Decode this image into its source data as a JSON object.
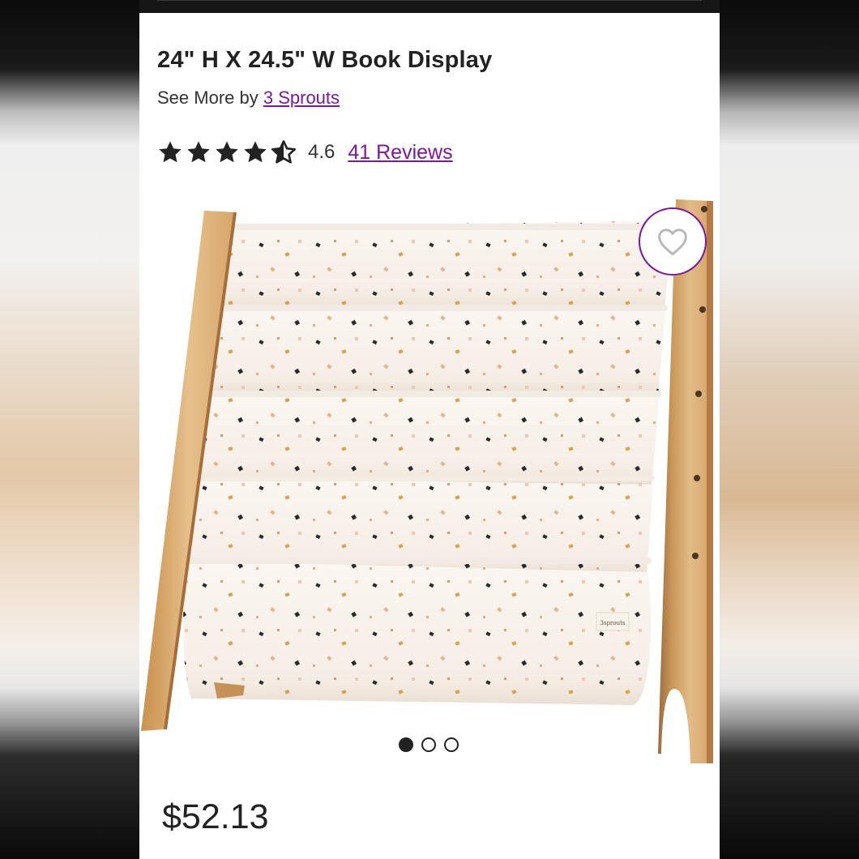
{
  "product": {
    "title": "24\" H X 24.5\" W Book Display",
    "see_more_prefix": "See More by",
    "brand": "3 Sprouts",
    "rating": "4.6",
    "rating_fraction": 0.92,
    "reviews_link": "41 Reviews",
    "price": "$52.13",
    "image_alt": "Book display with wooden sides and speckled fabric slings",
    "image_label": "3sprouts"
  },
  "carousel": {
    "total": 3,
    "active": 1
  },
  "colors": {
    "link": "#7b189f",
    "text": "#222222",
    "wood": "#dcb17f",
    "fabric": "#fbf5f0"
  }
}
